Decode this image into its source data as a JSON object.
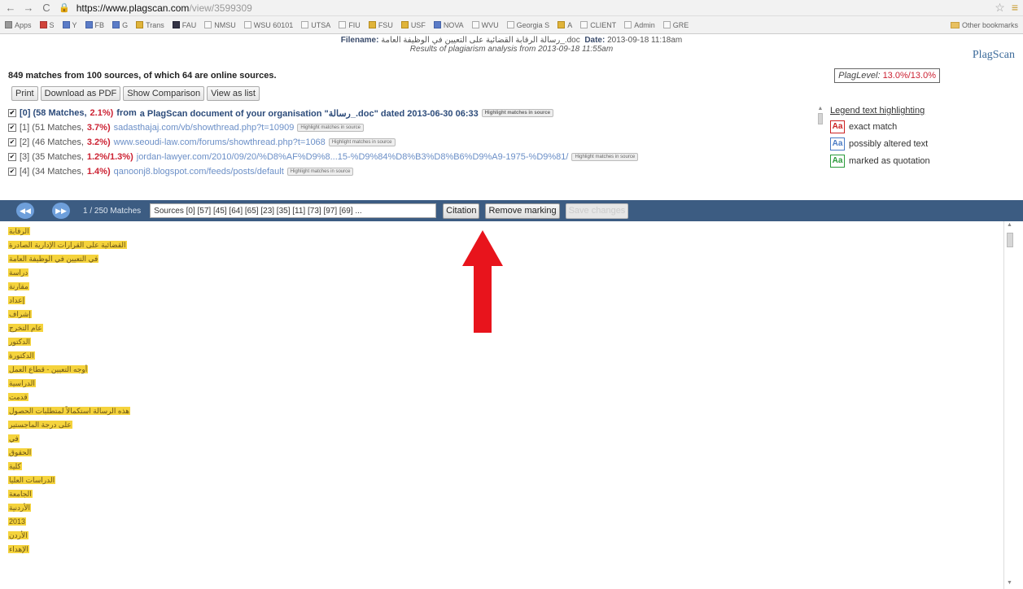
{
  "browser": {
    "url_host": "https://www.plagscan.com",
    "url_path": "/view/3599309",
    "bookmarks": [
      {
        "label": "Apps",
        "color": "gray"
      },
      {
        "label": "S",
        "color": "red"
      },
      {
        "label": "Y",
        "color": "blue"
      },
      {
        "label": "FB",
        "color": "blue"
      },
      {
        "label": "G",
        "color": "blue"
      },
      {
        "label": "Trans",
        "color": "gold"
      },
      {
        "label": "FAU",
        "color": "dark"
      },
      {
        "label": "NMSU",
        "color": "none"
      },
      {
        "label": "WSU 60101",
        "color": "none"
      },
      {
        "label": "UTSA",
        "color": "none"
      },
      {
        "label": "FIU",
        "color": "none"
      },
      {
        "label": "FSU",
        "color": "gold"
      },
      {
        "label": "USF",
        "color": "gold"
      },
      {
        "label": "NOVA",
        "color": "blue"
      },
      {
        "label": "WVU",
        "color": "none"
      },
      {
        "label": "Georgia S",
        "color": "none"
      },
      {
        "label": "A",
        "color": "gold"
      },
      {
        "label": "CLIENT",
        "color": "none"
      },
      {
        "label": "Admin",
        "color": "none"
      },
      {
        "label": "GRE",
        "color": "none"
      }
    ],
    "other_bookmarks": "Other bookmarks"
  },
  "header": {
    "filename_label": "Filename:",
    "filename": "رسالة الرقابة القضائية على التعيين في الوظيفة العامة_.doc",
    "date_label": "Date:",
    "date": "2013-09-18 11:18am",
    "results": "Results of plagiarism analysis from 2013-09-18 11:55am",
    "logo": "PlagScan"
  },
  "summary": {
    "count_text": "849 matches from 100 sources, of which 64 are online sources.",
    "plaglevel_label": "PlagLevel:",
    "plaglevel_value": "13.0%/13.0%"
  },
  "buttons": [
    "Print",
    "Download as PDF",
    "Show Comparison",
    "View as list"
  ],
  "sources": [
    {
      "prefix": "[0] (58 Matches,",
      "pct": "2.1%)",
      "rest": "from",
      "link": "a PlagScan document of your organisation \"رسالة_.doc\" dated 2013-06-30 06:33"
    },
    {
      "prefix": "[1] (51 Matches,",
      "pct": "3.7%)",
      "rest": "",
      "link": "sadasthajaj.com/vb/showthread.php?t=10909"
    },
    {
      "prefix": "[2] (46 Matches,",
      "pct": "3.2%)",
      "rest": "",
      "link": "www.seoudi-law.com/forums/showthread.php?t=1068"
    },
    {
      "prefix": "[3] (35 Matches,",
      "pct": "1.2%/1.3%)",
      "rest": "",
      "link": "jordan-lawyer.com/2010/09/20/%D8%AF%D9%8...15-%D9%84%D8%B3%D8%B6%D9%A9-1975-%D9%81/"
    },
    {
      "prefix": "[4] (34 Matches,",
      "pct": "1.4%)",
      "rest": "",
      "link": "qanoonj8.blogspot.com/feeds/posts/default"
    }
  ],
  "highlight_btn": "Highlight matches in source",
  "legend": {
    "title": "Legend text highlighting",
    "items": [
      "exact match",
      "possibly altered text",
      "marked as quotation"
    ],
    "aa": "Aa"
  },
  "toolbar": {
    "matches": "1 / 250 Matches",
    "sources_value": "Sources [0] [57] [45] [64] [65] [23] [35] [11] [73] [97] [69] ...",
    "citation": "Citation",
    "remove": "Remove marking",
    "save": "Save changes"
  },
  "doc_words": [
    "الرقابة",
    "القضائية على القرارات الإدارية الصادرة",
    "في التعيين في الوظيفة العامة",
    "دراسة",
    "مقارنة",
    "إعداد",
    "إشراف",
    "عام التخرج",
    "الدكتور",
    "الدكتورة",
    "أوجه التعيين - قطاع العمل",
    "الدراسية",
    "قدمت",
    "هذه الرسالة استكمالاً لمتطلبات الحصول",
    "على درجة الماجستير",
    "في",
    "الحقوق",
    "كلية",
    "الدراسات العليا",
    "الجامعة",
    "الأردنية",
    "2013",
    "الأردن",
    "الإهداء"
  ]
}
